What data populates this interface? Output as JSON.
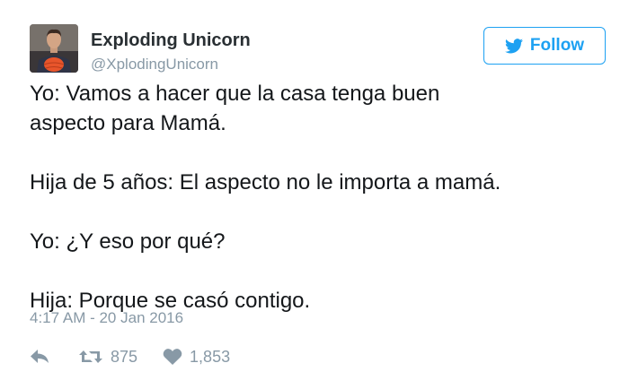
{
  "author": {
    "display_name": "Exploding Unicorn",
    "screen_name": "@XplodingUnicorn"
  },
  "follow_button": {
    "label": "Follow",
    "icon": "twitter-bird-icon"
  },
  "tweet": {
    "paragraphs": [
      [
        "Yo: Vamos a hacer que la casa tenga buen",
        "aspecto para Mamá."
      ],
      [
        "Hija de 5 años: El aspecto no le importa a mamá."
      ],
      [
        "Yo: ¿Y eso por qué?"
      ],
      [
        "Hija: Porque se casó contigo."
      ]
    ],
    "timestamp": "4:17 AM - 20 Jan 2016"
  },
  "actions": {
    "reply_icon": "reply-arrow-icon",
    "retweet_icon": "retweet-icon",
    "retweet_count": "875",
    "like_icon": "heart-icon",
    "like_count": "1,853"
  },
  "colors": {
    "twitter_blue": "#1da1f2",
    "muted_gray": "#8899a6",
    "text": "#14171a"
  }
}
